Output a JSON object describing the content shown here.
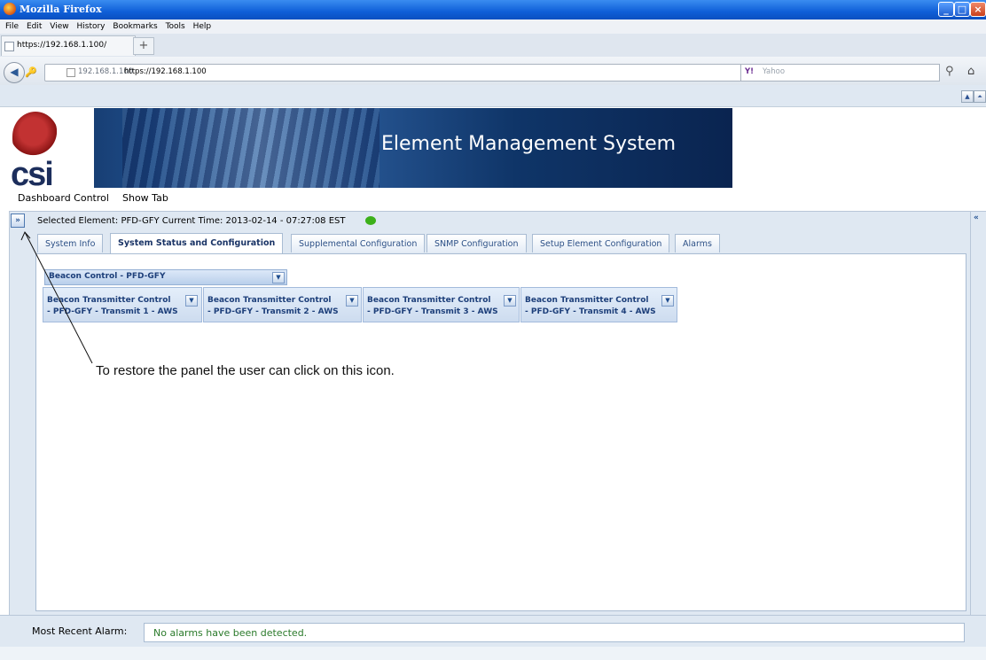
{
  "browser": {
    "window_title": "Mozilla Firefox",
    "menu": [
      "File",
      "Edit",
      "View",
      "History",
      "Bookmarks",
      "Tools",
      "Help"
    ],
    "tab_title": "https://192.168.1.100/",
    "new_tab_glyph": "+",
    "url_host": "192.168.1.100",
    "url_full": "https://192.168.1.100",
    "search_engine": "Yahoo"
  },
  "banner": {
    "logo_text": "csi",
    "title": "Element Management System"
  },
  "app_menu": {
    "dashboard_control": "Dashboard Control",
    "show_tab": "Show Tab"
  },
  "status": {
    "selected_element_label": "Selected Element:",
    "selected_element": "PFD-GFY",
    "current_time_label": "Current Time:",
    "current_time": "2013-02-14 - 07:27:08 EST",
    "indicator_color": "#3cb01a"
  },
  "tabs": [
    {
      "label": "System Info",
      "active": false
    },
    {
      "label": "System Status and Configuration",
      "active": true
    },
    {
      "label": "Supplemental Configuration",
      "active": false
    },
    {
      "label": "SNMP Configuration",
      "active": false
    },
    {
      "label": "Setup Element Configuration",
      "active": false
    },
    {
      "label": "Alarms",
      "active": false
    }
  ],
  "beacon_control": {
    "label": "Beacon Control - PFD-GFY"
  },
  "transmitters": [
    {
      "line1": "Beacon Transmitter Control",
      "line2": "- PFD-GFY - Transmit 1 - AWS"
    },
    {
      "line1": "Beacon Transmitter Control",
      "line2": "- PFD-GFY - Transmit 2 - AWS"
    },
    {
      "line1": "Beacon Transmitter Control",
      "line2": "- PFD-GFY - Transmit 3 - AWS"
    },
    {
      "line1": "Beacon Transmitter Control",
      "line2": "- PFD-GFY - Transmit 4 - AWS"
    }
  ],
  "annotation": "To restore the panel the user can click on this icon.",
  "alarm": {
    "label": "Most Recent Alarm:",
    "value": "No alarms have been detected."
  },
  "icons": {
    "expand": "»",
    "collapse": "«",
    "dropdown": "▼"
  }
}
